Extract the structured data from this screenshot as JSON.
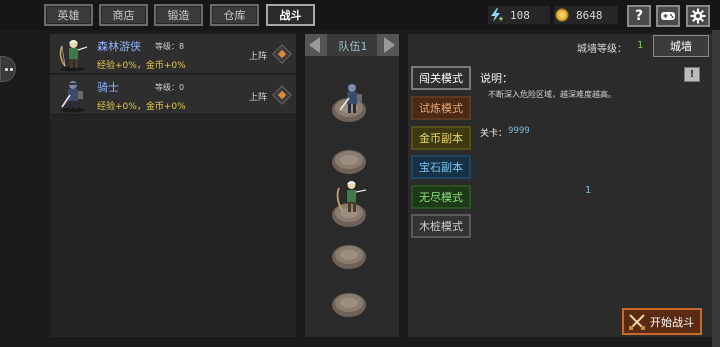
{
  "tabs": [
    {
      "label": "英雄",
      "active": false
    },
    {
      "label": "商店",
      "active": false
    },
    {
      "label": "锻造",
      "active": false
    },
    {
      "label": "仓库",
      "active": false
    },
    {
      "label": "战斗",
      "active": true
    }
  ],
  "resources": {
    "energy": "108",
    "gold": "8648",
    "energy_icon": "lightning-plus-icon",
    "gold_icon": "gold-coin-icon"
  },
  "header_buttons": [
    {
      "icon": "help-icon",
      "label": "?"
    },
    {
      "icon": "gamepad-icon"
    },
    {
      "icon": "settings-gear-icon"
    }
  ],
  "heroes": [
    {
      "name": "森林游侠",
      "level": "等级：8",
      "bonus": "经验+0%，金币+0%",
      "deploy": "上阵",
      "color": "#8fb4ff"
    },
    {
      "name": "骑士",
      "level": "等级：0",
      "bonus": "经验+0%，金币+0%",
      "deploy": "上阵",
      "color": "#8fb4ff"
    }
  ],
  "team": {
    "label": "队伍1"
  },
  "wall": {
    "label": "城墙等级：",
    "level": "1",
    "button": "城墙"
  },
  "modes": [
    {
      "label": "闯关模式",
      "bg": "#2f2f2f",
      "border": "#7a7a7a",
      "color": "#ffffff"
    },
    {
      "label": "试炼模式",
      "bg": "#4a2a14",
      "border": "#5a3a20",
      "color": "#e6a877"
    },
    {
      "label": "金币副本",
      "bg": "#3d3a12",
      "border": "#545018",
      "color": "#e6d26e"
    },
    {
      "label": "宝石副本",
      "bg": "#173247",
      "border": "#1f4560",
      "color": "#7cc4f0"
    },
    {
      "label": "无尽模式",
      "bg": "#1c3a18",
      "border": "#2a5222",
      "color": "#8fe07a"
    },
    {
      "label": "木桩模式",
      "bg": "#333333",
      "border": "#5a5a5a",
      "color": "#cfcfcf"
    }
  ],
  "description": {
    "title": "说明：",
    "text": "不断深入危险区域，越深难度越高。"
  },
  "stage": {
    "label": "关卡：",
    "value": "9999"
  },
  "page_number": "1",
  "start_button": "开始战斗"
}
